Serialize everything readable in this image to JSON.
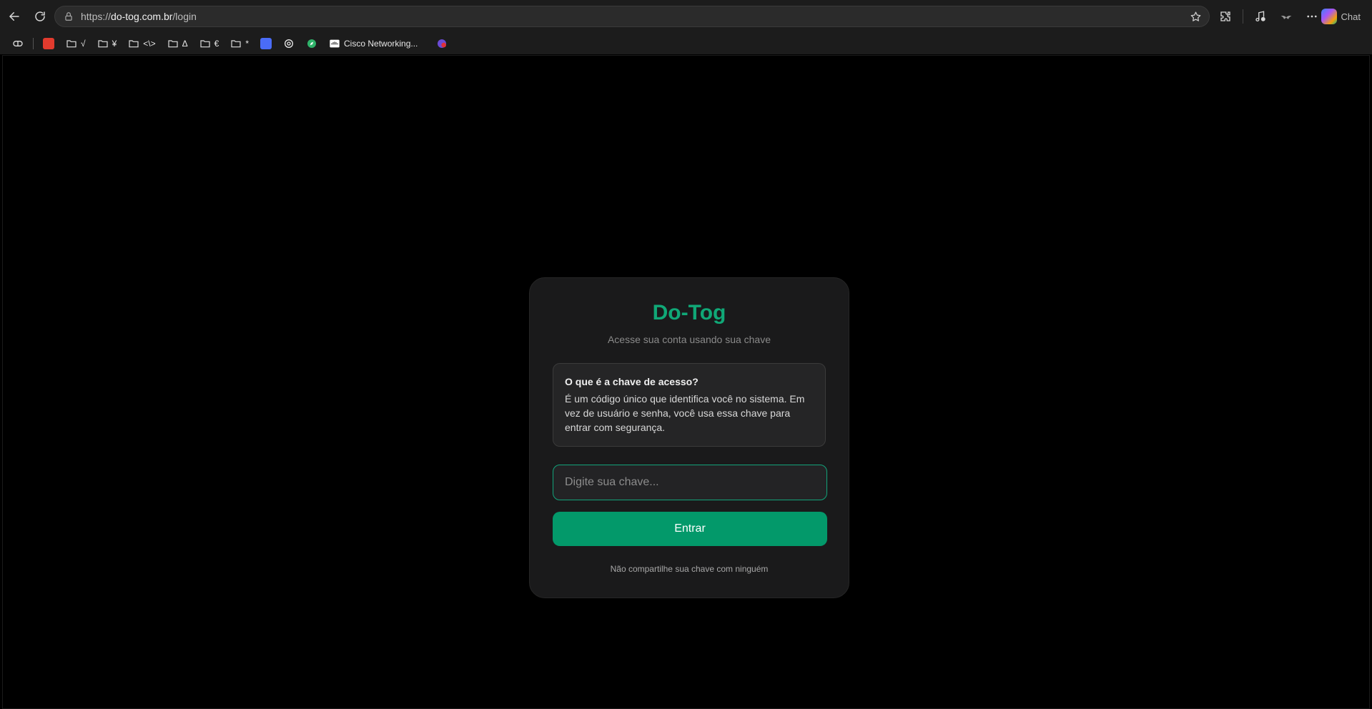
{
  "browser": {
    "url_scheme": "https://",
    "url_host": "do-tog.com.br",
    "url_path": "/login",
    "chat_label": "Chat",
    "bookmarks": [
      {
        "type": "icon",
        "icon": "pill-icon"
      },
      {
        "type": "favicon",
        "icon": "stack-app-icon",
        "color": "#e23b2e"
      },
      {
        "type": "folder",
        "label": "√"
      },
      {
        "type": "folder",
        "label": "¥"
      },
      {
        "type": "folder",
        "label": "<\\>"
      },
      {
        "type": "folder",
        "label": "Δ"
      },
      {
        "type": "folder",
        "label": "€"
      },
      {
        "type": "folder",
        "label": "*"
      },
      {
        "type": "favicon",
        "icon": "tools-app-icon",
        "color": "#4a6cf7"
      },
      {
        "type": "favicon",
        "icon": "openai-icon",
        "color": "#e8e8e8"
      },
      {
        "type": "favicon",
        "icon": "compass-icon",
        "color": "#2fb36a"
      },
      {
        "type": "favicon-label",
        "icon": "cisco-icon",
        "label": "Cisco Networking..."
      },
      {
        "type": "favicon",
        "icon": "badge-55-icon",
        "color": "#6b4bd6"
      }
    ]
  },
  "login": {
    "brand": "Do-Tog",
    "subtitle": "Acesse sua conta usando sua chave",
    "info_title": "O que é a chave de acesso?",
    "info_text": "É um código único que identifica você no sistema. Em vez de usuário e senha, você usa essa chave para entrar com segurança.",
    "key_placeholder": "Digite sua chave...",
    "key_value": "",
    "submit_label": "Entrar",
    "note": "Não compartilhe sua chave com ninguém"
  },
  "colors": {
    "accent": "#10a877",
    "button": "#03996a",
    "card_bg": "#1a1a1b",
    "page_bg": "#000000"
  }
}
